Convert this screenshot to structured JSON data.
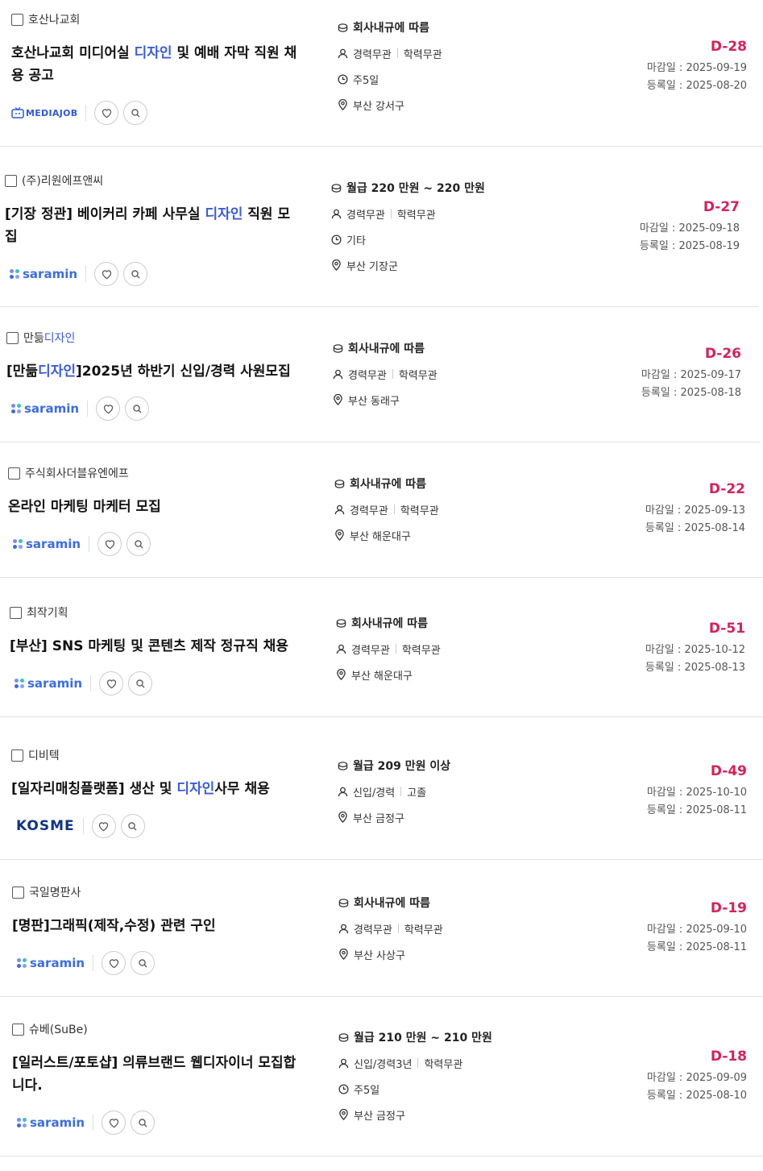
{
  "jobs": [
    {
      "company": "호산나교회",
      "title_parts": [
        "호산나교회 미디어실 ",
        "디자인",
        " 및 예배 자막 직원 채용 공고"
      ],
      "source_logo": "MEDIAJOB",
      "pay": "회사내규에 따름",
      "career": "경력무관",
      "education": "학력무관",
      "schedule": "주5일",
      "location": "부산 강서구",
      "dday": "D-28",
      "deadline": "마감일 : 2025-09-19",
      "registered": "등록일 : 2025-08-20"
    },
    {
      "company": "(주)리원에프앤씨",
      "title_parts": [
        "[기장 정관] 베이커리 카페 사무실 ",
        "디자인",
        " 직원 모집"
      ],
      "source_logo": "saramin",
      "pay": "월급 220 만원 ~ 220 만원",
      "career": "경력무관",
      "education": "학력무관",
      "schedule": "기타",
      "location": "부산 기장군",
      "dday": "D-27",
      "deadline": "마감일 : 2025-09-18",
      "registered": "등록일 : 2025-08-19"
    },
    {
      "company_parts": [
        "만듦",
        "디자인"
      ],
      "title_parts": [
        "[만듦",
        "디자인",
        "]2025년 하반기 신입/경력 사원모집"
      ],
      "source_logo": "saramin",
      "pay": "회사내규에 따름",
      "career": "경력무관",
      "education": "학력무관",
      "location": "부산 동래구",
      "dday": "D-26",
      "deadline": "마감일 : 2025-09-17",
      "registered": "등록일 : 2025-08-18"
    },
    {
      "company": "주식회사더블유엔에프",
      "title_parts": [
        "온라인 마케팅 마케터 모집",
        "",
        ""
      ],
      "source_logo": "saramin",
      "pay": "회사내규에 따름",
      "career": "경력무관",
      "education": "학력무관",
      "location": "부산 해운대구",
      "dday": "D-22",
      "deadline": "마감일 : 2025-09-13",
      "registered": "등록일 : 2025-08-14"
    },
    {
      "company": "최작기획",
      "title_parts": [
        "[부산] SNS 마케팅 및 콘텐츠 제작 정규직 채용",
        "",
        ""
      ],
      "source_logo": "saramin",
      "pay": "회사내규에 따름",
      "career": "경력무관",
      "education": "학력무관",
      "location": "부산 해운대구",
      "dday": "D-51",
      "deadline": "마감일 : 2025-10-12",
      "registered": "등록일 : 2025-08-13"
    },
    {
      "company": "디비텍",
      "title_parts": [
        "[일자리매칭플랫폼] 생산 및 ",
        "디자인",
        "사무 채용"
      ],
      "source_logo": "KOSME",
      "pay": "월급 209 만원 이상",
      "career": "신입/경력",
      "education": "고졸",
      "location": "부산 금정구",
      "dday": "D-49",
      "deadline": "마감일 : 2025-10-10",
      "registered": "등록일 : 2025-08-11"
    },
    {
      "company": "국일명판사",
      "title_parts": [
        "[명판]그래픽(제작,수정) 관련 구인",
        "",
        ""
      ],
      "source_logo": "saramin",
      "pay": "회사내규에 따름",
      "career": "경력무관",
      "education": "학력무관",
      "location": "부산 사상구",
      "dday": "D-19",
      "deadline": "마감일 : 2025-09-10",
      "registered": "등록일 : 2025-08-11"
    },
    {
      "company": "슈베(SuBe)",
      "title_parts": [
        "[일러스트/포토샵] 의류브랜드 웹디자이너 모집합니다.",
        "",
        ""
      ],
      "source_logo": "saramin",
      "pay": "월급 210 만원 ~ 210 만원",
      "career": "신입/경력3년",
      "education": "학력무관",
      "schedule": "주5일",
      "location": "부산 금정구",
      "dday": "D-18",
      "deadline": "마감일 : 2025-09-09",
      "registered": "등록일 : 2025-08-10"
    }
  ],
  "colors": {
    "highlight": "#3a5bd9",
    "dday": "#d6215b",
    "saramin": "#3c6de0"
  },
  "icons": [
    "coin-icon",
    "person-icon",
    "clock-icon",
    "location-pin-icon",
    "heart-icon",
    "search-icon"
  ]
}
